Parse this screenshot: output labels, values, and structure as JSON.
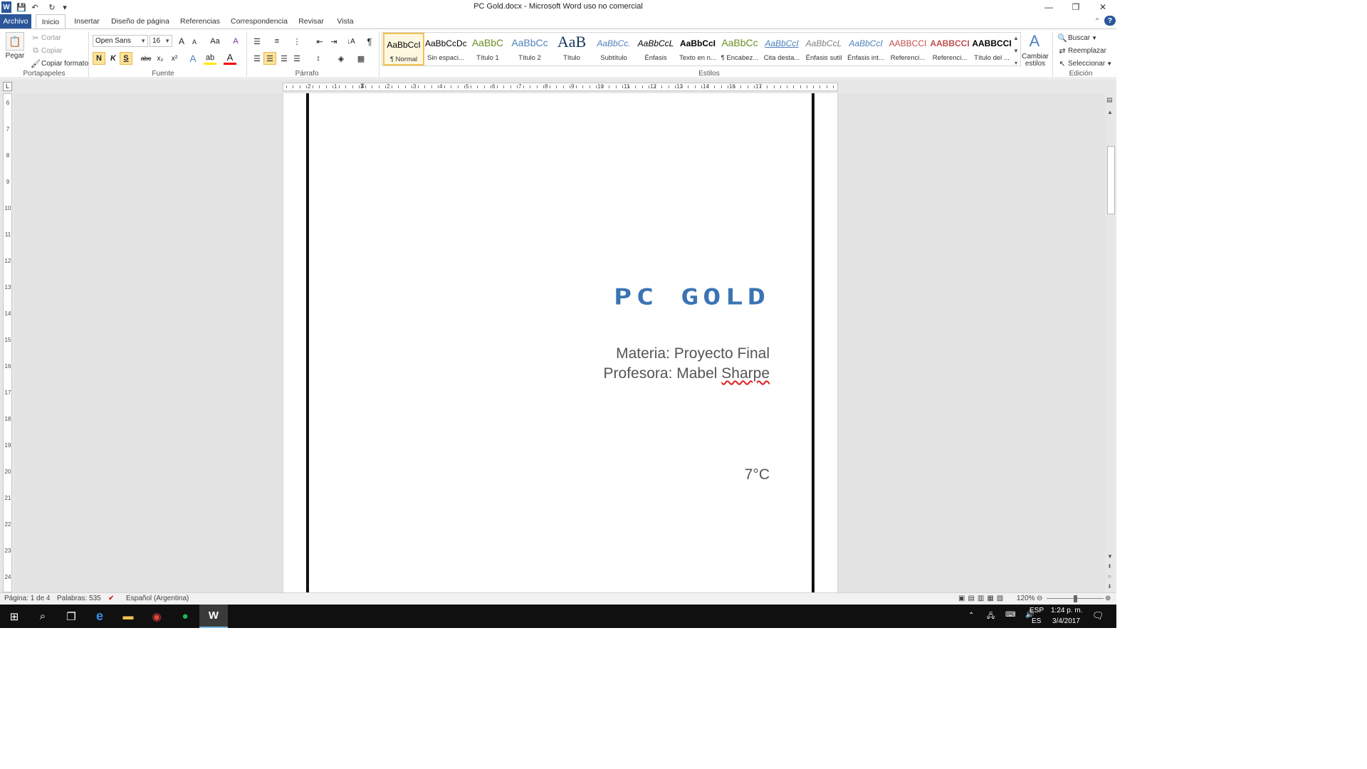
{
  "titlebar": {
    "title": "PC Gold.docx  -  Microsoft Word uso no comercial",
    "qat": {
      "save_label": "💾",
      "undo_label": "↶",
      "redo_label": "↻",
      "customize_label": "▾"
    },
    "window": {
      "minimize": "—",
      "restore": "❐",
      "close": "✕"
    }
  },
  "tabs": [
    {
      "label": "Archivo"
    },
    {
      "label": "Inicio"
    },
    {
      "label": "Insertar"
    },
    {
      "label": "Diseño de página"
    },
    {
      "label": "Referencias"
    },
    {
      "label": "Correspondencia"
    },
    {
      "label": "Revisar"
    },
    {
      "label": "Vista"
    }
  ],
  "ribbon": {
    "clipboard": {
      "paste": "Pegar",
      "cut": "Cortar",
      "copy": "Copiar",
      "format_painter": "Copiar formato",
      "group": "Portapapeles"
    },
    "font": {
      "name": "Open Sans",
      "size": "16",
      "group": "Fuente",
      "bold": "N",
      "italic": "K",
      "underline": "S",
      "strike": "abc",
      "subscript": "x₂",
      "superscript": "x²",
      "grow": "A",
      "shrink": "A",
      "case": "Aa",
      "clear": "A"
    },
    "paragraph": {
      "group": "Párrafo",
      "pilcrow": "¶"
    },
    "styles": {
      "group": "Estilos",
      "items": [
        {
          "preview": "AaBbCcI",
          "name": "¶ Normal",
          "color": "#000000"
        },
        {
          "preview": "AaBbCcDc",
          "name": "Sin espaci...",
          "color": "#000000"
        },
        {
          "preview": "AaBbC",
          "name": "Título 1",
          "color": "#6b8e23"
        },
        {
          "preview": "AaBbCc",
          "name": "Título 2",
          "color": "#4f81bd"
        },
        {
          "preview": "AaB",
          "name": "Título",
          "color": "#17365d"
        },
        {
          "preview": "AaBbCc.",
          "name": "Subtítulo",
          "color": "#4f81bd"
        },
        {
          "preview": "AaBbCcL",
          "name": "Énfasis",
          "color": "#000000"
        },
        {
          "preview": "AaBbCcI",
          "name": "Texto en n...",
          "color": "#000000"
        },
        {
          "preview": "AaBbCc",
          "name": "¶ Encabez...",
          "color": "#6b8e23"
        },
        {
          "preview": "AaBbCcI",
          "name": "Cita desta...",
          "color": "#4f81bd"
        },
        {
          "preview": "AaBbCcL",
          "name": "Énfasis sutil",
          "color": "#808080"
        },
        {
          "preview": "AaBbCcI",
          "name": "Énfasis int...",
          "color": "#4f81bd"
        },
        {
          "preview": "AABBCCI",
          "name": "Referenci...",
          "color": "#c0504d"
        },
        {
          "preview": "AABBCCI",
          "name": "Referenci...",
          "color": "#c0504d"
        },
        {
          "preview": "AABBCCI",
          "name": "Título del ...",
          "color": "#000000"
        }
      ],
      "change": "Cambiar estilos"
    },
    "editing": {
      "group": "Edición",
      "find": "Buscar",
      "replace": "Reemplazar",
      "select": "Seleccionar"
    }
  },
  "document": {
    "logo": "PC GOLD",
    "line1": "Materia: Proyecto Final",
    "line2_prefix": "Profesora: Mabel ",
    "line2_misspelled": "Sharpe",
    "temperature": "7°C"
  },
  "statusbar": {
    "page": "Página: 1 de 4",
    "words": "Palabras: 535",
    "language": "Español (Argentina)",
    "zoom": "120%"
  },
  "taskbar": {
    "lang_top": "ESP",
    "lang_bottom": "ES",
    "time": "1:24 p. m.",
    "date": "3/4/2017"
  },
  "ruler": {
    "h_labels": [
      "2",
      "1",
      "1",
      "2",
      "3",
      "4",
      "5",
      "6",
      "7",
      "8",
      "9",
      "10",
      "11",
      "12",
      "13",
      "14",
      "16",
      "17"
    ],
    "v_labels": [
      "6",
      "7",
      "8",
      "9",
      "10",
      "11",
      "12",
      "13",
      "14",
      "15",
      "16",
      "17",
      "18",
      "19",
      "20",
      "21",
      "22",
      "23",
      "24"
    ]
  },
  "colors": {
    "accent": "#2b579a",
    "logo": "#3b74b4"
  }
}
